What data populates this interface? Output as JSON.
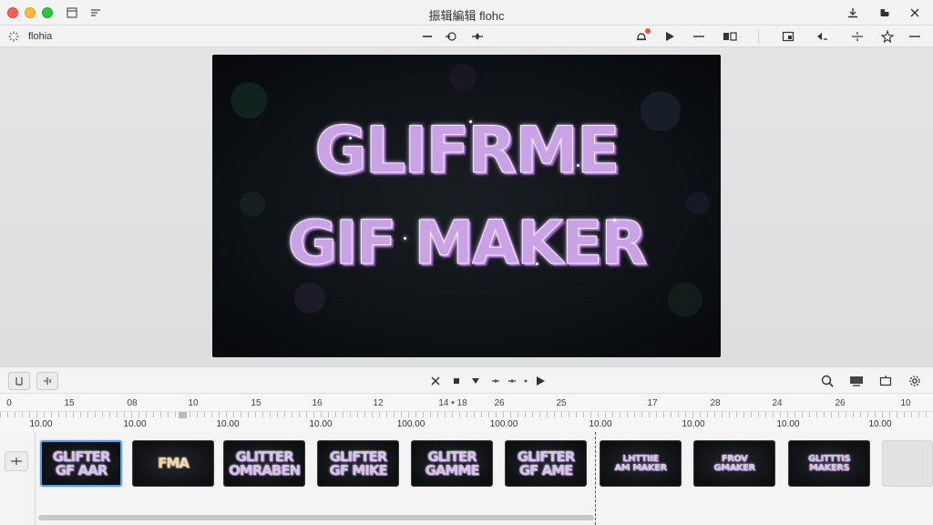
{
  "window": {
    "title": "振辑編辑 flohc"
  },
  "toolbar": {
    "label": "flohia"
  },
  "preview": {
    "line1": "GLIFRME",
    "line2": "GIF MAKER"
  },
  "ruler": {
    "labels": [
      "0",
      "15",
      "08",
      "10",
      "15",
      "16",
      "12",
      "14 • 18",
      "26",
      "25",
      "17",
      "28",
      "24",
      "26",
      "10"
    ]
  },
  "timecodes": [
    "10.00",
    "10.00",
    "10.00",
    "10.00",
    "100.00",
    "100.00",
    "10.00",
    "10.00",
    "10.00",
    "10.00"
  ],
  "frames": [
    {
      "text": "GLIFTER\nGF AAR"
    },
    {
      "text": "FMA"
    },
    {
      "text": "GLITTER\nOMRABEN"
    },
    {
      "text": "GLIFTER\nGF MIKE"
    },
    {
      "text": "GLITER\nGAMME"
    },
    {
      "text": "GLIFTER\nGF AME"
    },
    {
      "text": "LHTTIIE\nAM MAKER"
    },
    {
      "text": "FROV\nGMAKER"
    },
    {
      "text": "GLITTTIS\nMAKERS"
    }
  ],
  "colors": {
    "accent": "#5aa0e6",
    "glitter": "#c9a3e6",
    "record": "#ff4a3d"
  }
}
